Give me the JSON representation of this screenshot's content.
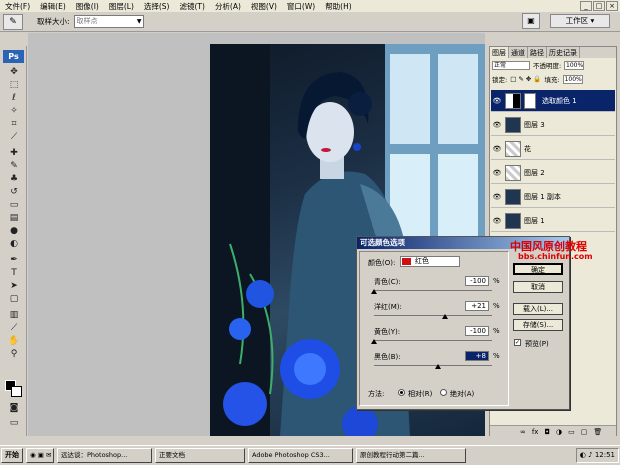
{
  "menu": {
    "items": [
      "文件(F)",
      "编辑(E)",
      "图像(I)",
      "图层(L)",
      "选择(S)",
      "滤镜(T)",
      "分析(A)",
      "视图(V)",
      "窗口(W)",
      "帮助(H)"
    ]
  },
  "options_bar": {
    "sample_size_label": "取样大小:",
    "sample_size_value": "取样点",
    "workspace_label": "工作区 ▾"
  },
  "toolbox": {
    "logo": "Ps"
  },
  "layers_panel": {
    "tabs": [
      "图层",
      "通道",
      "路径",
      "历史记录"
    ],
    "blend_mode": "正常",
    "opacity_label": "不透明度:",
    "opacity_value": "100%",
    "lock_label": "锁定:",
    "fill_label": "填充:",
    "fill_value": "100%",
    "layers": [
      {
        "name": "选取颜色 1",
        "selected": true
      },
      {
        "name": "图层 3",
        "selected": false
      },
      {
        "name": "花",
        "selected": false
      },
      {
        "name": "图层 2",
        "selected": false
      },
      {
        "name": "图层 1 副本",
        "selected": false
      },
      {
        "name": "图层 1",
        "selected": false
      }
    ]
  },
  "dialog": {
    "title": "可选颜色选项",
    "colors_label": "颜色(O):",
    "colors_value": "红色",
    "cyan_label": "青色(C):",
    "cyan_value": "-100",
    "magenta_label": "洋红(M):",
    "magenta_value": "+21",
    "yellow_label": "黄色(Y):",
    "yellow_value": "-100",
    "black_label": "黑色(B):",
    "black_value": "+8",
    "percent": "%",
    "method_label": "方法:",
    "relative_label": "相对(R)",
    "absolute_label": "绝对(A)",
    "ok_label": "确定",
    "cancel_label": "取消",
    "load_label": "载入(L)...",
    "save_label": "存储(S)...",
    "preview_label": "预览(P)",
    "slider_levels": {
      "cyan": -100,
      "magenta": 21,
      "yellow": -100,
      "black": 8
    }
  },
  "watermark": {
    "line1": "中国风原创教程",
    "line2": "bbs.chinfun.com"
  },
  "taskbar": {
    "start_label": "开始",
    "items": [
      "远达谈：Photoshop...",
      "正要文档",
      "Adobe Photoshop CS3...",
      "原创教程行动第二篇..."
    ],
    "clock": "12:51"
  }
}
